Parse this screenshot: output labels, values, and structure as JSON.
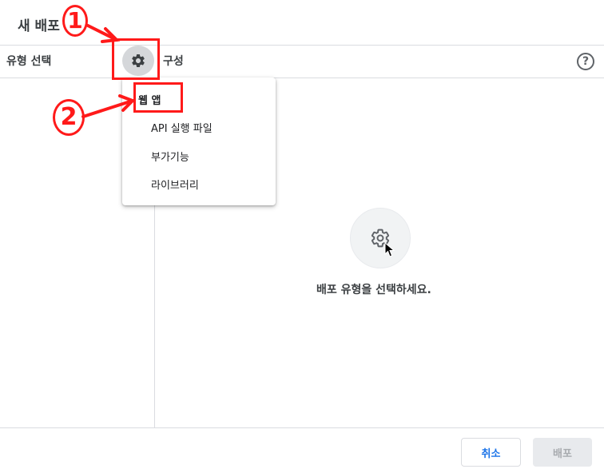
{
  "dialog": {
    "title": "새 배포"
  },
  "left_panel": {
    "label": "유형 선택",
    "gear_icon": "gear-icon"
  },
  "right_panel": {
    "label": "구성",
    "help_icon": "help-icon",
    "help_glyph": "?",
    "empty_icon": "gear-icon",
    "empty_message": "배포 유형을 선택하세요."
  },
  "type_menu": {
    "items": [
      {
        "label": "웹 앱"
      },
      {
        "label": "API 실행 파일"
      },
      {
        "label": "부가기능"
      },
      {
        "label": "라이브러리"
      }
    ]
  },
  "footer": {
    "cancel_label": "취소",
    "deploy_label": "배포"
  },
  "annotations": {
    "step1": "①",
    "step2": "②",
    "color": "#ff1a1a"
  }
}
